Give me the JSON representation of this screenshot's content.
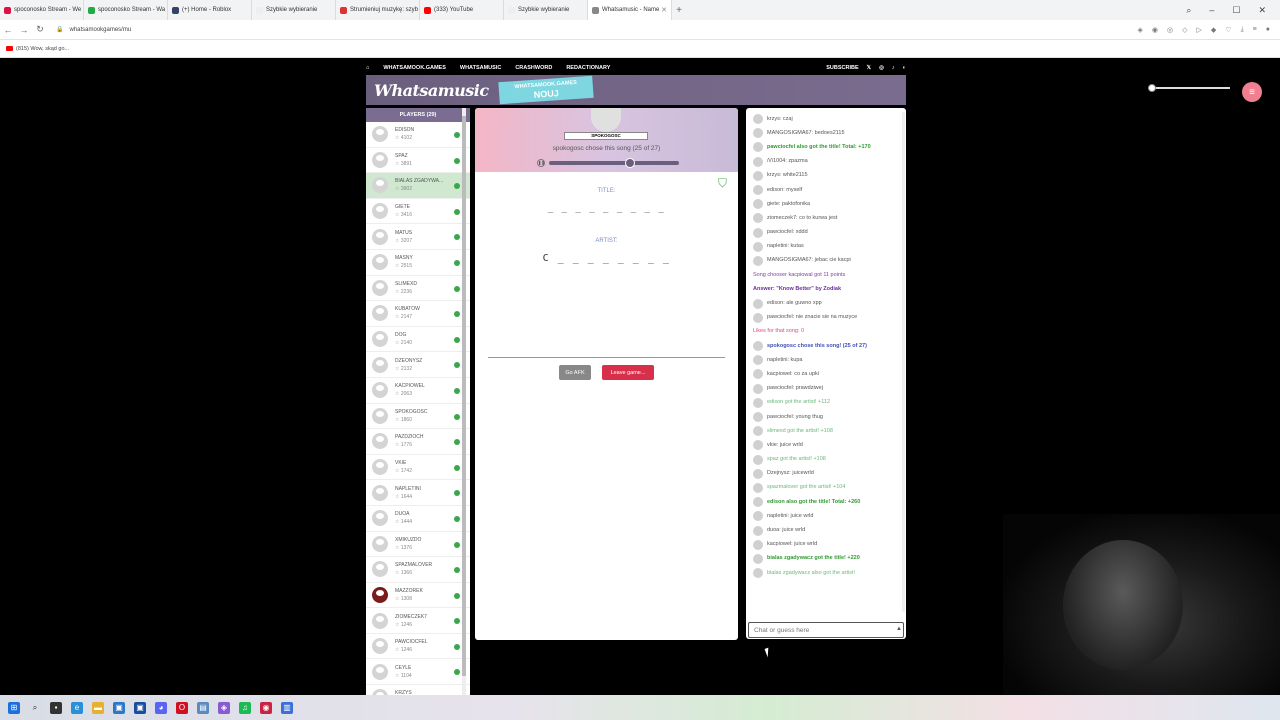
{
  "browser": {
    "tabs": [
      {
        "label": "spoconosko Stream - We",
        "color": "#d14",
        "active": false
      },
      {
        "label": "spoconosko Stream - Wa",
        "color": "#2a4",
        "active": false
      },
      {
        "label": "(+) Home - Roblox",
        "color": "#346",
        "active": false
      },
      {
        "label": "Szybkie wybieranie",
        "color": "#eee",
        "active": false
      },
      {
        "label": "Strumieniuj muzykę: szyb",
        "color": "#d33",
        "active": false
      },
      {
        "label": "(333) YouTube",
        "color": "#f00",
        "active": false
      },
      {
        "label": "Szybkie wybieranie",
        "color": "#eee",
        "active": false
      },
      {
        "label": "Whatsamusic - Name",
        "color": "#888",
        "active": true
      }
    ],
    "url": "whatsamookgames/mu",
    "bookmark": "(815) Wow, skąd go..."
  },
  "site_nav": {
    "items": [
      "WHATSAMOOK.GAMES",
      "WHATSAMUSIC",
      "CRASHWORD",
      "REDACTIONARY"
    ],
    "subscribe": "SUBSCRIBE"
  },
  "banner": {
    "logo": "Whatsamusic",
    "promo_small": "WHATSAMOOK.GAMES",
    "promo_big": "NOUJ"
  },
  "players": {
    "header": "PLAYERS (29)",
    "list": [
      {
        "name": "EDISON",
        "score": "4102",
        "hl": false
      },
      {
        "name": "SPAZ",
        "score": "3891",
        "hl": false
      },
      {
        "name": "BIALAS ZGADYWA...",
        "score": "3902",
        "hl": true
      },
      {
        "name": "GIETE",
        "score": "3416",
        "hl": false
      },
      {
        "name": "MATUS",
        "score": "3207",
        "hl": false
      },
      {
        "name": "MASNY",
        "score": "2515",
        "hl": false
      },
      {
        "name": "SLIMEXD",
        "score": "2236",
        "hl": false
      },
      {
        "name": "KUBATOW",
        "score": "2147",
        "hl": false
      },
      {
        "name": "DOG",
        "score": "2140",
        "hl": false
      },
      {
        "name": "DZEONYSZ",
        "score": "2132",
        "hl": false
      },
      {
        "name": "KACPIOWEL",
        "score": "2063",
        "hl": false
      },
      {
        "name": "SPOKOGOSC",
        "score": "1860",
        "hl": false
      },
      {
        "name": "PAZDZIOCH",
        "score": "1776",
        "hl": false
      },
      {
        "name": "VKIE",
        "score": "1742",
        "hl": false
      },
      {
        "name": "NAPLETINI",
        "score": "1644",
        "hl": false
      },
      {
        "name": "DUOA",
        "score": "1444",
        "hl": false
      },
      {
        "name": "XMIKUZDO",
        "score": "1376",
        "hl": false
      },
      {
        "name": "SPAZMALOVER",
        "score": "1366",
        "hl": false
      },
      {
        "name": "MAZZOREK",
        "score": "1308",
        "hl": false
      },
      {
        "name": "ZIOMECZEK7",
        "score": "1246",
        "hl": false
      },
      {
        "name": "PAWCIOCFEL",
        "score": "1246",
        "hl": false
      },
      {
        "name": "CEYLE",
        "score": "1104",
        "hl": false
      },
      {
        "name": "KRZYS",
        "score": "",
        "hl": false
      }
    ]
  },
  "game": {
    "chooser": "SPOKOGOSC",
    "chose_text": "spokogosc chose this song (25 of 27)",
    "progress": 0.62,
    "title_label": "TITLE:",
    "title_hint": "_ _ _ _ _   _ _ _ _",
    "artist_label": "ARTIST:",
    "artist_hint": "C _ _ _ _   _ _ _ _",
    "afk_button": "Go AFK",
    "leave_button": "Leave game..."
  },
  "chat": {
    "messages": [
      {
        "text": "krzys: czaj",
        "style": "normal",
        "avatar": true
      },
      {
        "text": "MANGOSIGMA67: bedoes2115",
        "style": "normal",
        "avatar": true
      },
      {
        "text": "pawciocfel also got the title! Total: +170",
        "style": "green",
        "avatar": true
      },
      {
        "text": "/\\/\\1004: zpazma",
        "style": "normal",
        "avatar": true
      },
      {
        "text": "krzys: white2115",
        "style": "normal",
        "avatar": true
      },
      {
        "text": "edison: myself",
        "style": "normal",
        "avatar": true
      },
      {
        "text": "giete: paktofonika",
        "style": "normal",
        "avatar": true
      },
      {
        "text": "ziomeczek7: co to kurwa jest",
        "style": "normal",
        "avatar": true
      },
      {
        "text": "pawciocfel: xddd",
        "style": "normal",
        "avatar": true
      },
      {
        "text": "napletini: kutas",
        "style": "normal",
        "avatar": true
      },
      {
        "text": "MANGOSIGMA67: jebac cie kacpi",
        "style": "normal",
        "avatar": true
      },
      {
        "text": "Song chooser kacpiowal got 11 points",
        "style": "purple",
        "avatar": false
      },
      {
        "text": "Answer: \"Know Better\" by Zodiak",
        "style": "purplebold",
        "avatar": false
      },
      {
        "text": "edison: ale guwno xpp",
        "style": "normal",
        "avatar": true
      },
      {
        "text": "pawciocfel: nie znacie sie na muzyce",
        "style": "normal",
        "avatar": true
      },
      {
        "text": "Likes for that song: 0",
        "style": "pink",
        "avatar": false
      },
      {
        "text": "spokogosc chose this song! (25 of 27)",
        "style": "blue",
        "avatar": true
      },
      {
        "text": "napletini: kupa",
        "style": "normal",
        "avatar": true
      },
      {
        "text": "kacpiowel: co za upki",
        "style": "normal",
        "avatar": true
      },
      {
        "text": "pawciocfel: prawdziwej",
        "style": "normal",
        "avatar": true
      },
      {
        "text": "edison got the artist! +112",
        "style": "lightgreen",
        "avatar": true
      },
      {
        "text": "pawciocfel: young thug",
        "style": "normal",
        "avatar": true
      },
      {
        "text": "slimexd got the artist! +108",
        "style": "lightgreen",
        "avatar": true
      },
      {
        "text": "vkie: juice wrld",
        "style": "normal",
        "avatar": true
      },
      {
        "text": "spaz got the artist! +108",
        "style": "lightgreen",
        "avatar": true
      },
      {
        "text": "Dzejnysz: juicewrld",
        "style": "normal",
        "avatar": true
      },
      {
        "text": "spazmalover got the artist! +104",
        "style": "lightgreen",
        "avatar": true
      },
      {
        "text": "edison also got the title! Total: +260",
        "style": "green",
        "avatar": true
      },
      {
        "text": "napletini: juice wrld",
        "style": "normal",
        "avatar": true
      },
      {
        "text": "duoa: juice wrld",
        "style": "normal",
        "avatar": true
      },
      {
        "text": "kacpiowel: juice wrld",
        "style": "normal",
        "avatar": true
      },
      {
        "text": "bialas zgadywacz got the title! +220",
        "style": "green",
        "avatar": true
      },
      {
        "text": "bialas zgadywacz also got the artist!",
        "style": "lightgreen",
        "avatar": true
      }
    ],
    "input_placeholder": "Chat or guess here"
  }
}
